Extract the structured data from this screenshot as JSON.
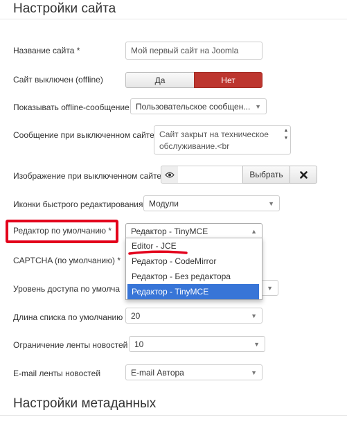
{
  "section": {
    "title": "Настройки сайта"
  },
  "fields": {
    "site_name": {
      "label": "Название сайта *",
      "value": "Мой первый сайт на Joomla"
    },
    "offline": {
      "label": "Сайт выключен (offline)",
      "yes": "Да",
      "no": "Нет",
      "active": "no"
    },
    "offline_message_show": {
      "label": "Показывать offline-сообщение",
      "value": "Пользовательское сообщен..."
    },
    "offline_message": {
      "label": "Сообщение при выключенном сайте",
      "value": "Сайт закрыт на техническое обслуживание.<br"
    },
    "offline_image": {
      "label": "Изображение при выключенном сайте",
      "select_label": "Выбрать"
    },
    "frontend_editing": {
      "label": "Иконки быстрого редактирования",
      "value": "Модули"
    },
    "default_editor": {
      "label": "Редактор по умолчанию *",
      "value": "Редактор - TinyMCE",
      "options": [
        "Editor - JCE",
        "Редактор - CodeMirror",
        "Редактор - Без редактора",
        "Редактор - TinyMCE"
      ],
      "selected_index": 3
    },
    "captcha": {
      "label": "CAPTCHA (по умолчанию) *"
    },
    "access": {
      "label": "Уровень доступа по умолча"
    },
    "list_limit": {
      "label": "Длина списка по умолчанию",
      "value": "20"
    },
    "feed_limit": {
      "label": "Ограничение ленты новостей",
      "value": "10"
    },
    "feed_email": {
      "label": "E-mail ленты новостей",
      "value": "E-mail Автора"
    }
  },
  "next_section": {
    "title": "Настройки метаданных"
  },
  "colors": {
    "danger": "#bd362f",
    "highlight": "#e3001b",
    "selected_option": "#3875d7"
  },
  "icons": {
    "eye": "eye-icon",
    "clear": "close-icon",
    "arrow": "chevron-down-icon"
  }
}
